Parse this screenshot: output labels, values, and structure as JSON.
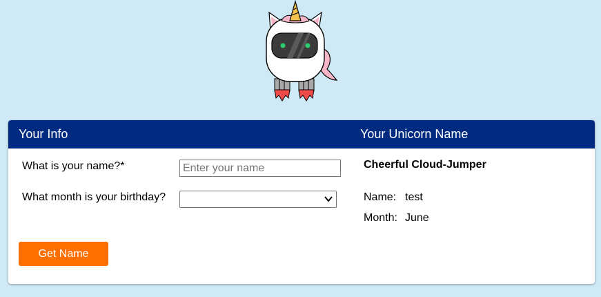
{
  "mascot": {
    "icon": "unicorn-robot-icon"
  },
  "header": {
    "left_title": "Your Info",
    "right_title": "Your Unicorn Name",
    "color": "#002b80"
  },
  "form": {
    "name_label": "What is your name?*",
    "name_placeholder": "Enter your name",
    "name_value": "",
    "month_label": "What month is your birthday?",
    "month_selected": ""
  },
  "button": {
    "label": "Get Name",
    "color": "#ff6f00"
  },
  "result": {
    "unicorn_name": "Cheerful Cloud-Jumper",
    "name_label": "Name:",
    "name_value": "test",
    "month_label": "Month:",
    "month_value": "June"
  }
}
